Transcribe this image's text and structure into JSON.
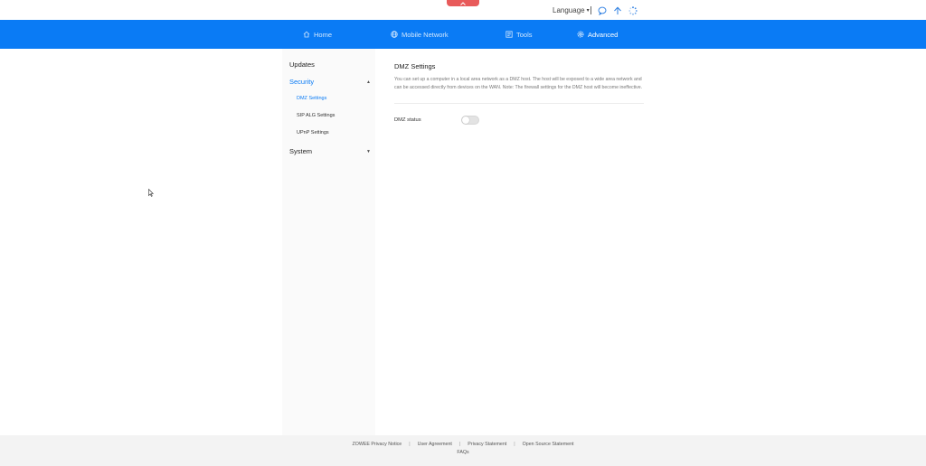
{
  "topbar": {
    "language_label": "Language",
    "icons": [
      "messages-icon",
      "update-arrow-icon",
      "loading-spinner-icon"
    ]
  },
  "nav": {
    "items": [
      {
        "label": "Home",
        "icon": "home-icon",
        "active": false
      },
      {
        "label": "Mobile Network",
        "icon": "globe-icon",
        "active": false
      },
      {
        "label": "Tools",
        "icon": "tools-icon",
        "active": false
      },
      {
        "label": "Advanced",
        "icon": "gear-icon",
        "active": true
      }
    ],
    "accent_color": "#0a7bf5"
  },
  "sidebar": {
    "items": [
      {
        "label": "Updates"
      },
      {
        "label": "Security",
        "expanded": true
      },
      {
        "label": "DMZ Settings",
        "selected": true
      },
      {
        "label": "SIP ALG Settings"
      },
      {
        "label": "UPnP Settings"
      },
      {
        "label": "System",
        "expanded": false
      }
    ]
  },
  "main": {
    "title": "DMZ Settings",
    "description": "You can set up a computer in a local area network as a DMZ host. The host will be exposed to a wide area network and can be accessed directly from devices on the WAN. Note: The firewall settings for the DMZ host will become ineffective.",
    "dmz_status_label": "DMZ status",
    "dmz_status_on": false
  },
  "footer": {
    "links": [
      "ZOWEE Privacy Notice",
      "User Agreement",
      "Privacy Statement",
      "Open Source Statement"
    ],
    "faqs": "FAQs"
  }
}
